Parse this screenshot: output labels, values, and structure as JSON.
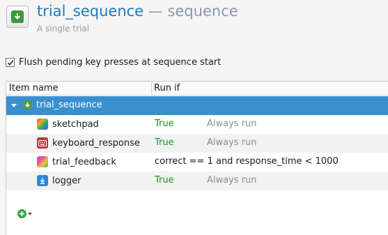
{
  "header": {
    "item_name": "trial_sequence",
    "separator": " — ",
    "item_type": "sequence",
    "description": "A single trial",
    "icon": "sequence-download-icon"
  },
  "flush": {
    "label": "Flush pending key presses at sequence start",
    "checked": true
  },
  "tree": {
    "columns": [
      "Item name",
      "Run if"
    ],
    "root": {
      "name": "trial_sequence",
      "icon": "sequence-icon",
      "expanded": true
    },
    "items": [
      {
        "name": "sketchpad",
        "icon": "sketchpad-icon",
        "run_if": "True",
        "note": "Always run"
      },
      {
        "name": "keyboard_response",
        "icon": "keyboard-icon",
        "run_if": "True",
        "note": "Always run"
      },
      {
        "name": "trial_feedback",
        "icon": "feedback-icon",
        "run_if": "correct == 1 and response_time < 1000",
        "note": ""
      },
      {
        "name": "logger",
        "icon": "logger-icon",
        "run_if": "True",
        "note": "Always run"
      }
    ]
  },
  "add_button": {
    "icon": "plus-circle-icon"
  },
  "colors": {
    "accent": "#1d7bbd",
    "selection": "#3a8fcf",
    "true_text": "#1e8e1e",
    "muted": "#8b8b8b"
  }
}
